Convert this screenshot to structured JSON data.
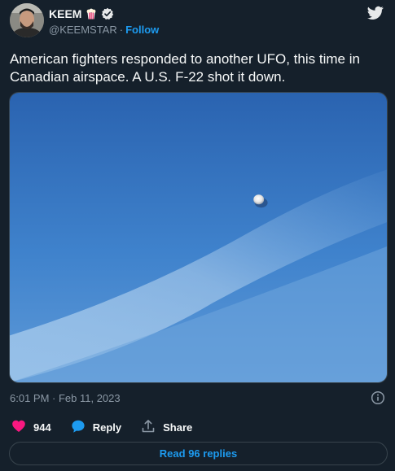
{
  "author": {
    "display_name": "KEEM",
    "handle": "@KEEMSTAR",
    "separator": "·",
    "follow_label": "Follow",
    "emoji": "popcorn-icon",
    "verified": "verified-badge-icon"
  },
  "tweet": {
    "text": "American fighters responded to another UFO, this time in Canadian airspace. A U.S. F-22 shot it down.",
    "timestamp": "6:01 PM · Feb 11, 2023"
  },
  "media": {
    "description_icon": "photo-media",
    "sky_colors": [
      "#2b66b3",
      "#4a8bd0",
      "#9ec3e8"
    ]
  },
  "actions": {
    "like_count": "944",
    "reply_label": "Reply",
    "share_label": "Share"
  },
  "footer": {
    "read_replies_label": "Read 96 replies"
  },
  "colors": {
    "background": "#15202b",
    "accent": "#1d9bf0",
    "like": "#f91880",
    "muted": "#8b98a5",
    "border": "#38444d"
  }
}
